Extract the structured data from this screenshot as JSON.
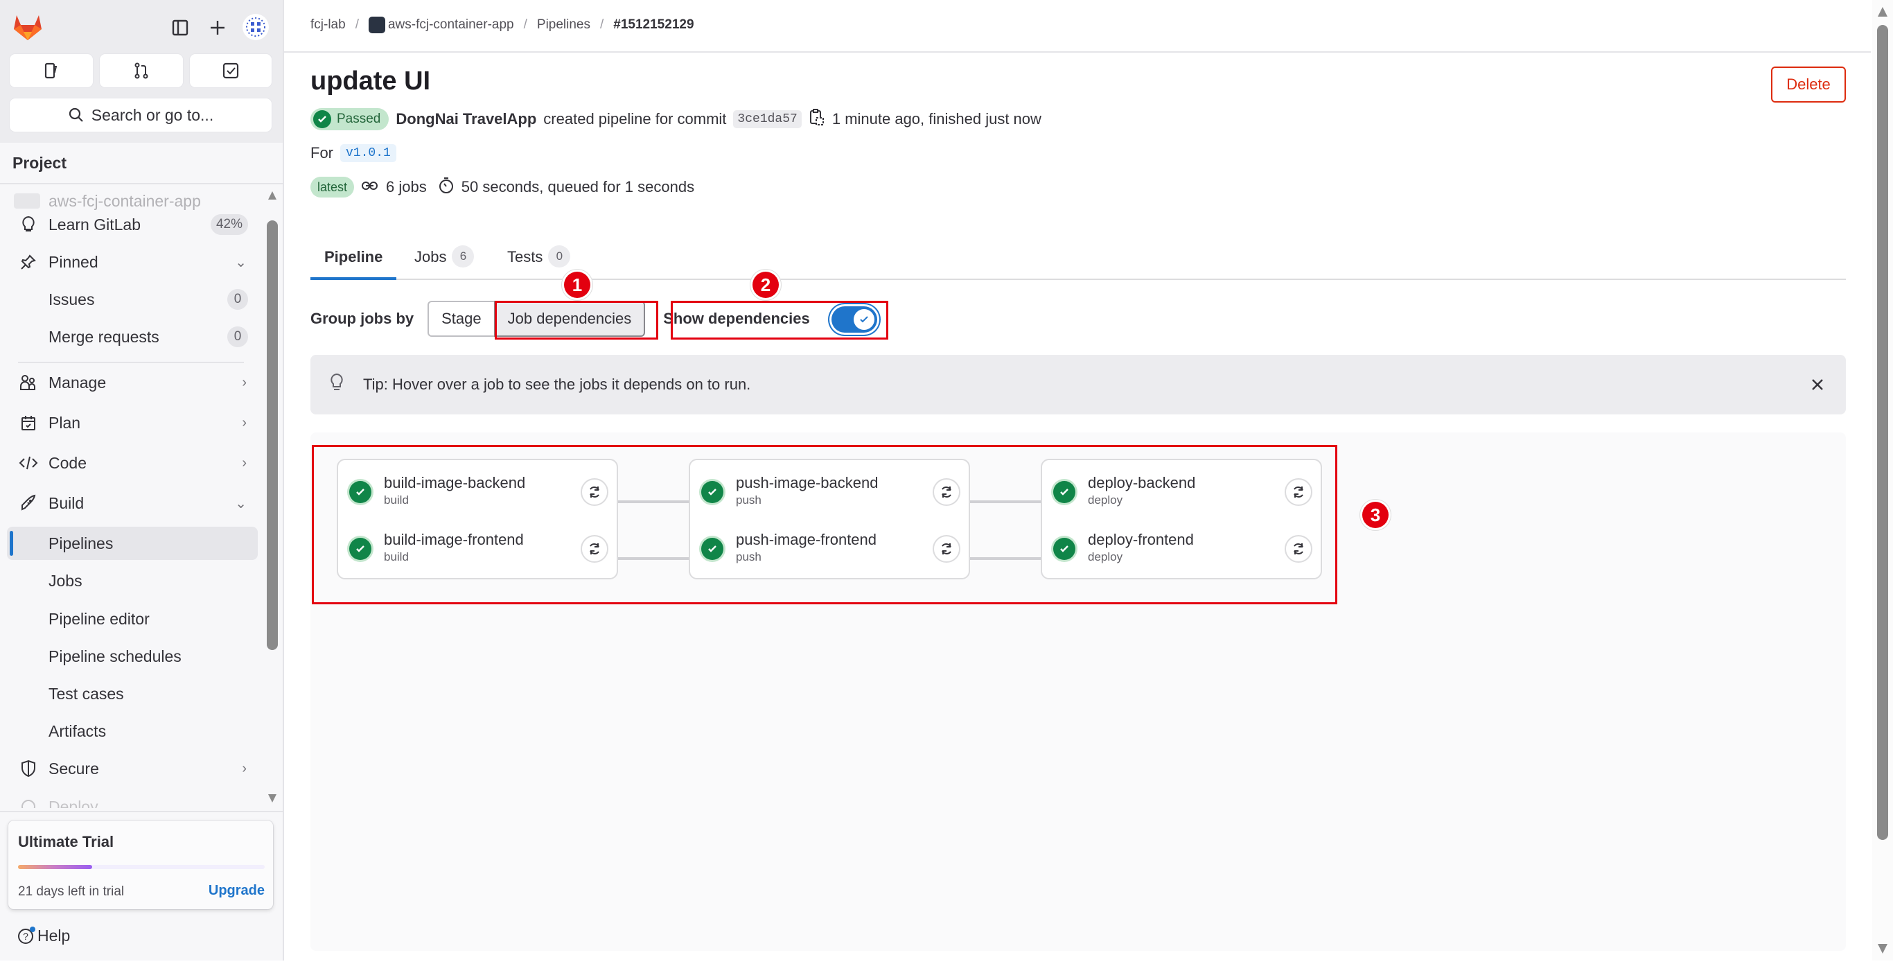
{
  "sidebar": {
    "top_icons": [
      "gitlab-logo",
      "sidebar-toggle-icon",
      "plus-icon",
      "user-avatar"
    ],
    "quick_buttons": [
      "issues-icon",
      "merge-requests-icon",
      "todo-icon"
    ],
    "search_placeholder": "Search or go to...",
    "section_title": "Project",
    "faded_project": "aws-fcj-container-app",
    "items": [
      {
        "label": "Learn GitLab",
        "icon": "bulb-icon",
        "badge": "42%"
      },
      {
        "label": "Pinned",
        "icon": "pin-icon",
        "chevron": "down"
      },
      {
        "label": "Issues",
        "badge": "0"
      },
      {
        "label": "Merge requests",
        "badge": "0"
      },
      {
        "label": "Manage",
        "icon": "users-icon",
        "chevron": "right"
      },
      {
        "label": "Plan",
        "icon": "calendar-icon",
        "chevron": "right"
      },
      {
        "label": "Code",
        "icon": "code-icon",
        "chevron": "right"
      },
      {
        "label": "Build",
        "icon": "rocket-icon",
        "chevron": "down"
      },
      {
        "label": "Pipelines",
        "active": true
      },
      {
        "label": "Jobs"
      },
      {
        "label": "Pipeline editor"
      },
      {
        "label": "Pipeline schedules"
      },
      {
        "label": "Test cases"
      },
      {
        "label": "Artifacts"
      },
      {
        "label": "Secure",
        "icon": "shield-icon",
        "chevron": "right"
      },
      {
        "label": "Deploy",
        "icon": "deploy-icon",
        "chevron": "right"
      }
    ],
    "trial": {
      "title": "Ultimate Trial",
      "progress": 0.3,
      "days_left": "21 days left in trial",
      "upgrade": "Upgrade"
    },
    "help": "Help"
  },
  "breadcrumb": {
    "items": [
      "fcj-lab",
      "aws-fcj-container-app",
      "Pipelines",
      "#1512152129"
    ]
  },
  "pipeline": {
    "title": "update UI",
    "delete_label": "Delete",
    "status": "Passed",
    "author": "DongNai TravelApp",
    "created_text": "created pipeline for commit",
    "commit_sha": "3ce1da57",
    "timing": "1 minute ago, finished just now",
    "for_label": "For",
    "ref": "v1.0.1",
    "latest_badge": "latest",
    "jobs_count": "6 jobs",
    "duration": "50 seconds, queued for 1 seconds"
  },
  "tabs": [
    {
      "label": "Pipeline",
      "active": true
    },
    {
      "label": "Jobs",
      "count": "6"
    },
    {
      "label": "Tests",
      "count": "0"
    }
  ],
  "controls": {
    "group_by_label": "Group jobs by",
    "options": [
      "Stage",
      "Job dependencies"
    ],
    "selected": "Job dependencies",
    "show_dependencies_label": "Show dependencies",
    "show_dependencies": true
  },
  "tip": {
    "text": "Tip: Hover over a job to see the jobs it depends on to run."
  },
  "callouts": [
    "1",
    "2",
    "3"
  ],
  "stages": [
    {
      "jobs": [
        {
          "name": "build-image-backend",
          "stage": "build",
          "status": "passed"
        },
        {
          "name": "build-image-frontend",
          "stage": "build",
          "status": "passed"
        }
      ]
    },
    {
      "jobs": [
        {
          "name": "push-image-backend",
          "stage": "push",
          "status": "passed"
        },
        {
          "name": "push-image-frontend",
          "stage": "push",
          "status": "passed"
        }
      ]
    },
    {
      "jobs": [
        {
          "name": "deploy-backend",
          "stage": "deploy",
          "status": "passed"
        },
        {
          "name": "deploy-frontend",
          "stage": "deploy",
          "status": "passed"
        }
      ]
    }
  ],
  "colors": {
    "success": "#108548",
    "accent": "#1f75cb",
    "danger": "#dd2b0e",
    "highlight": "#e3000f"
  }
}
